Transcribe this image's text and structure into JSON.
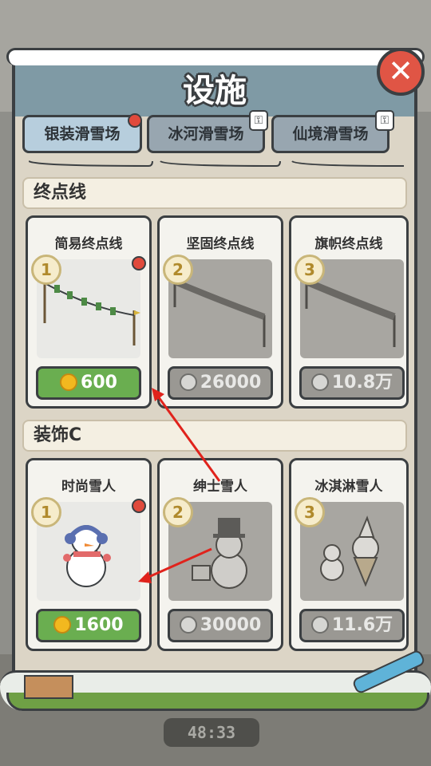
{
  "background": {
    "timer": "48:33"
  },
  "panel": {
    "title": "设施",
    "tabs": [
      {
        "label": "银装滑雪场",
        "state": "active",
        "badge": true
      },
      {
        "label": "冰河滑雪场",
        "state": "locked"
      },
      {
        "label": "仙境滑雪场",
        "state": "locked"
      }
    ],
    "sections": [
      {
        "title": "终点线",
        "items": [
          {
            "name": "简易终点线",
            "level": "1",
            "price": "600",
            "currency": "gold-coin",
            "locked": false,
            "badge": true
          },
          {
            "name": "坚固终点线",
            "level": "2",
            "price": "26000",
            "currency": "silver-coin",
            "locked": true
          },
          {
            "name": "旗帜终点线",
            "level": "3",
            "price": "10.8万",
            "currency": "silver-coin",
            "locked": true
          }
        ]
      },
      {
        "title": "装饰C",
        "items": [
          {
            "name": "时尚雪人",
            "level": "1",
            "price": "1600",
            "currency": "gold-coin",
            "locked": false,
            "badge": true
          },
          {
            "name": "绅士雪人",
            "level": "2",
            "price": "30000",
            "currency": "silver-coin",
            "locked": true
          },
          {
            "name": "冰淇淋雪人",
            "level": "3",
            "price": "11.6万",
            "currency": "silver-coin",
            "locked": true
          }
        ]
      }
    ]
  },
  "colors": {
    "buy_green": "#6aae50",
    "locked_gray": "#9a9893",
    "badge_red": "#e04a3c",
    "title_blue": "#7f9aa5",
    "close_red": "#e05545",
    "annotation_arrow": "#e0231c"
  }
}
